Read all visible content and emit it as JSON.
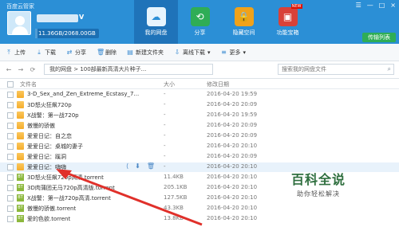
{
  "app": {
    "title": "百度云管家",
    "vip_badge": "V"
  },
  "window_controls": [
    "☰",
    "—",
    "□",
    "×"
  ],
  "account": {
    "quota_text": "11.36GB/2068.00GB",
    "quota_used_fraction": 0.0055
  },
  "top_nav": [
    {
      "label": "我的网盘",
      "active": true,
      "icon": "cloud-icon"
    },
    {
      "label": "分享",
      "active": false,
      "icon": "share-icon"
    },
    {
      "label": "隐藏空间",
      "active": false,
      "icon": "vault-icon"
    },
    {
      "label": "功能宝箱",
      "active": false,
      "icon": "store-icon"
    }
  ],
  "transfer_button": "传输列表",
  "toolbar": [
    {
      "label": "上传",
      "icon": "upload-icon"
    },
    {
      "label": "下载",
      "icon": "download-icon"
    },
    {
      "label": "分享",
      "icon": "share-icon"
    },
    {
      "label": "删除",
      "icon": "delete-icon"
    },
    {
      "label": "新建文件夹",
      "icon": "new-folder-icon"
    },
    {
      "label": "离线下载",
      "icon": "offline-download-icon"
    },
    {
      "label": "更多",
      "icon": "more-icon"
    }
  ],
  "path_bar": {
    "breadcrumb": "我的网盘  >  100部最新高清大片种子...",
    "search_placeholder": "搜索我的网盘文件"
  },
  "table": {
    "columns": [
      "文件名",
      "大小",
      "修改日期"
    ],
    "rows": [
      {
        "name": "3-D_Sex_and_Zen_Extreme_Ecstasy_7...",
        "size": "-",
        "date": "2016-04-20 19:59",
        "type": "folder"
      },
      {
        "name": "3D怒火狂飙720p",
        "size": "-",
        "date": "2016-04-20 20:09",
        "type": "folder"
      },
      {
        "name": "X战警：第一战720p",
        "size": "-",
        "date": "2016-04-20 19:59",
        "type": "folder"
      },
      {
        "name": "傲慢的骄傲",
        "size": "-",
        "date": "2016-04-20 20:09",
        "type": "folder"
      },
      {
        "name": "爱爱日记：自之恋",
        "size": "-",
        "date": "2016-04-20 20:09",
        "type": "folder"
      },
      {
        "name": "爱爱日记：桌城的妻子",
        "size": "-",
        "date": "2016-04-20 20:10",
        "type": "folder"
      },
      {
        "name": "爱爱日记：蹊洞",
        "size": "-",
        "date": "2016-04-20 20:09",
        "type": "folder"
      },
      {
        "name": "爱爱日记：嗨嗨",
        "size": "-",
        "date": "2016-04-20 20:10",
        "type": "folder",
        "selected": true
      },
      {
        "name": "3D怒火狂飙720p高清.torrent",
        "size": "11.4KB",
        "date": "2016-04-20 20:10",
        "type": "torrent"
      },
      {
        "name": "3D肉蒲团无马720p高清版.torrent",
        "size": "205.1KB",
        "date": "2016-04-20 20:10",
        "type": "torrent"
      },
      {
        "name": "X战警：第一战720p高清.torrent",
        "size": "127.5KB",
        "date": "2016-04-20 20:10",
        "type": "torrent"
      },
      {
        "name": "傲慢的骄傲.torrent",
        "size": "43.3KB",
        "date": "2016-04-20 20:10",
        "type": "torrent"
      },
      {
        "name": "爱的色欲.torrent",
        "size": "13.8KB",
        "date": "2016-04-20 20:10",
        "type": "torrent"
      }
    ]
  },
  "row_actions": [
    "share-icon",
    "download-icon",
    "delete-icon"
  ],
  "watermark": {
    "title": "百科全说",
    "subtitle": "助你轻松解决"
  }
}
